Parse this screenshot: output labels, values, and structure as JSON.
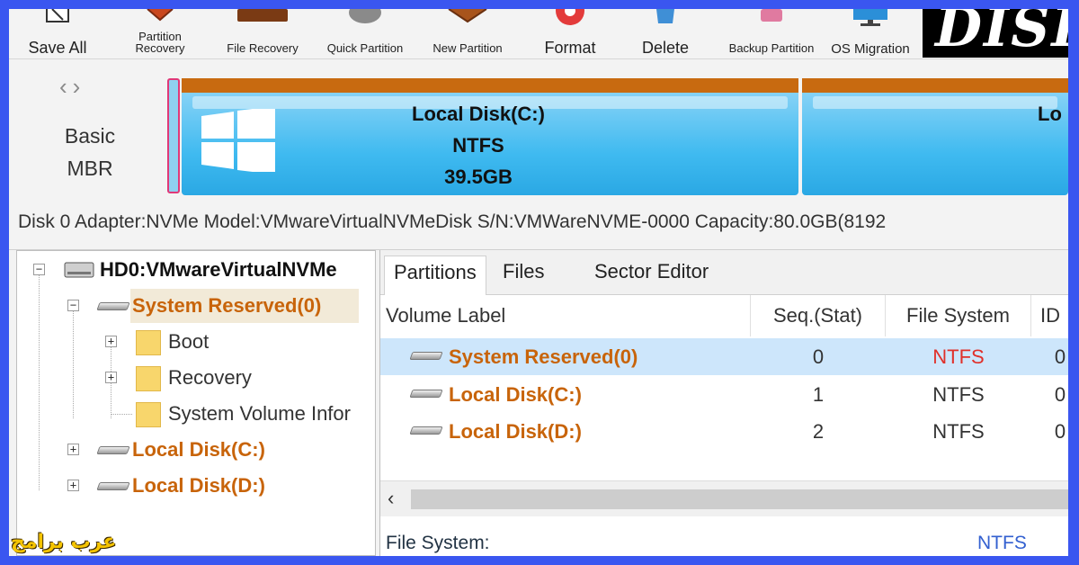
{
  "toolbar": {
    "items": [
      {
        "label": "Save All",
        "icon": "save-icon"
      },
      {
        "label": "Partition Recovery",
        "icon": "partition-recovery-icon"
      },
      {
        "label": "File Recovery",
        "icon": "file-recovery-icon"
      },
      {
        "label": "Quick Partition",
        "icon": "quick-partition-icon"
      },
      {
        "label": "New Partition",
        "icon": "new-partition-icon"
      },
      {
        "label": "Format",
        "icon": "format-icon"
      },
      {
        "label": "Delete",
        "icon": "delete-icon"
      },
      {
        "label": "Backup Partition",
        "icon": "backup-partition-icon"
      },
      {
        "label": "OS Migration",
        "icon": "os-migration-icon"
      }
    ],
    "logo_text": "DISK"
  },
  "diskmap": {
    "disk_type_line1": "Basic",
    "disk_type_line2": "MBR",
    "partition_c": {
      "name": "Local Disk(C:)",
      "fs": "NTFS",
      "size": "39.5GB"
    },
    "partition_d": {
      "name": "Lo"
    }
  },
  "disk_info": "Disk 0 Adapter:NVMe  Model:VMwareVirtualNVMeDisk  S/N:VMWareNVME-0000  Capacity:80.0GB(8192",
  "tree": {
    "root": "HD0:VMwareVirtualNVMe",
    "system_reserved": "System Reserved(0)",
    "boot": "Boot",
    "recovery": "Recovery",
    "svi": "System Volume Infor",
    "local_c": "Local Disk(C:)",
    "local_d": "Local Disk(D:)"
  },
  "tabs": [
    "Partitions",
    "Files",
    "Sector Editor"
  ],
  "grid": {
    "columns": [
      "Volume Label",
      "Seq.(Stat)",
      "File System",
      "ID"
    ],
    "rows": [
      {
        "label": "System Reserved(0)",
        "seq": "0",
        "fs": "NTFS",
        "id": "0"
      },
      {
        "label": "Local Disk(C:)",
        "seq": "1",
        "fs": "NTFS",
        "id": "0"
      },
      {
        "label": "Local Disk(D:)",
        "seq": "2",
        "fs": "NTFS",
        "id": "0"
      }
    ]
  },
  "summary": {
    "label": "File System:",
    "value": "NTFS"
  },
  "watermark": "عرب برامج",
  "colors": {
    "accent_blue": "#3a56f0",
    "partition_orange": "#c86a10",
    "selected_row": "#cde6fb",
    "ntfs_red": "#e0302a"
  }
}
